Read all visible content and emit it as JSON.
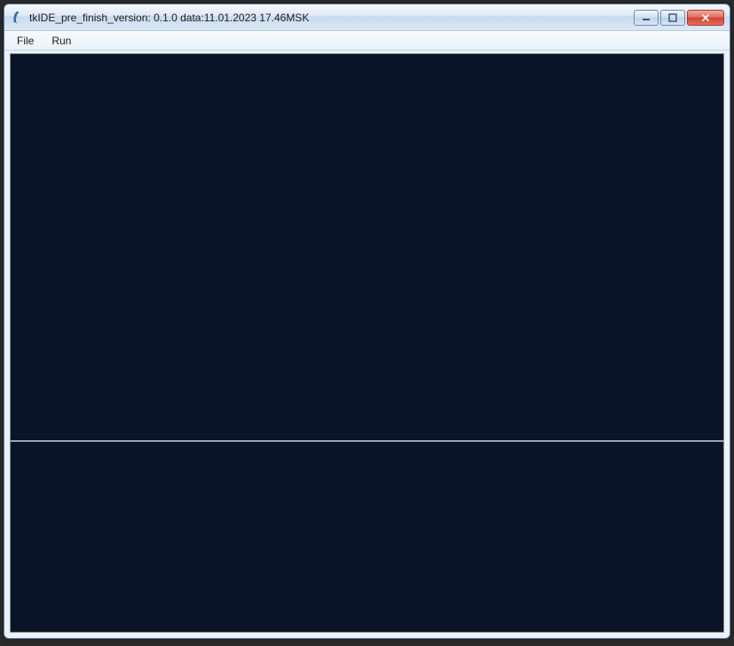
{
  "window": {
    "title": "tkIDE_pre_finish_version: 0.1.0 data:11.01.2023 17.46MSK",
    "icon_name": "tk-feather-icon"
  },
  "menubar": {
    "items": [
      {
        "label": "File"
      },
      {
        "label": "Run"
      }
    ]
  },
  "editor": {
    "content": ""
  },
  "output": {
    "content": ""
  },
  "colors": {
    "pane_background": "#0a1428",
    "titlebar_gradient_top": "#f4f8fc",
    "titlebar_gradient_bottom": "#dbe7f4",
    "close_button": "#d1412f"
  }
}
